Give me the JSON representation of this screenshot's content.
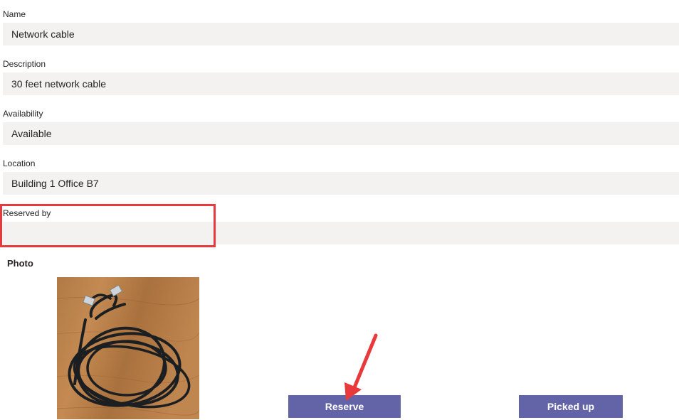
{
  "form": {
    "name": {
      "label": "Name",
      "value": "Network cable"
    },
    "description": {
      "label": "Description",
      "value": "30 feet network cable"
    },
    "availability": {
      "label": "Availability",
      "value": "Available"
    },
    "location": {
      "label": "Location",
      "value": "Building 1 Office B7"
    },
    "reserved_by": {
      "label": "Reserved by",
      "value": ""
    },
    "photo": {
      "heading": "Photo"
    }
  },
  "actions": {
    "reserve_label": "Reserve",
    "picked_up_label": "Picked up"
  },
  "colors": {
    "button": "#6264a7",
    "field_background": "#f3f2f1",
    "annotation": "#e8393d"
  }
}
